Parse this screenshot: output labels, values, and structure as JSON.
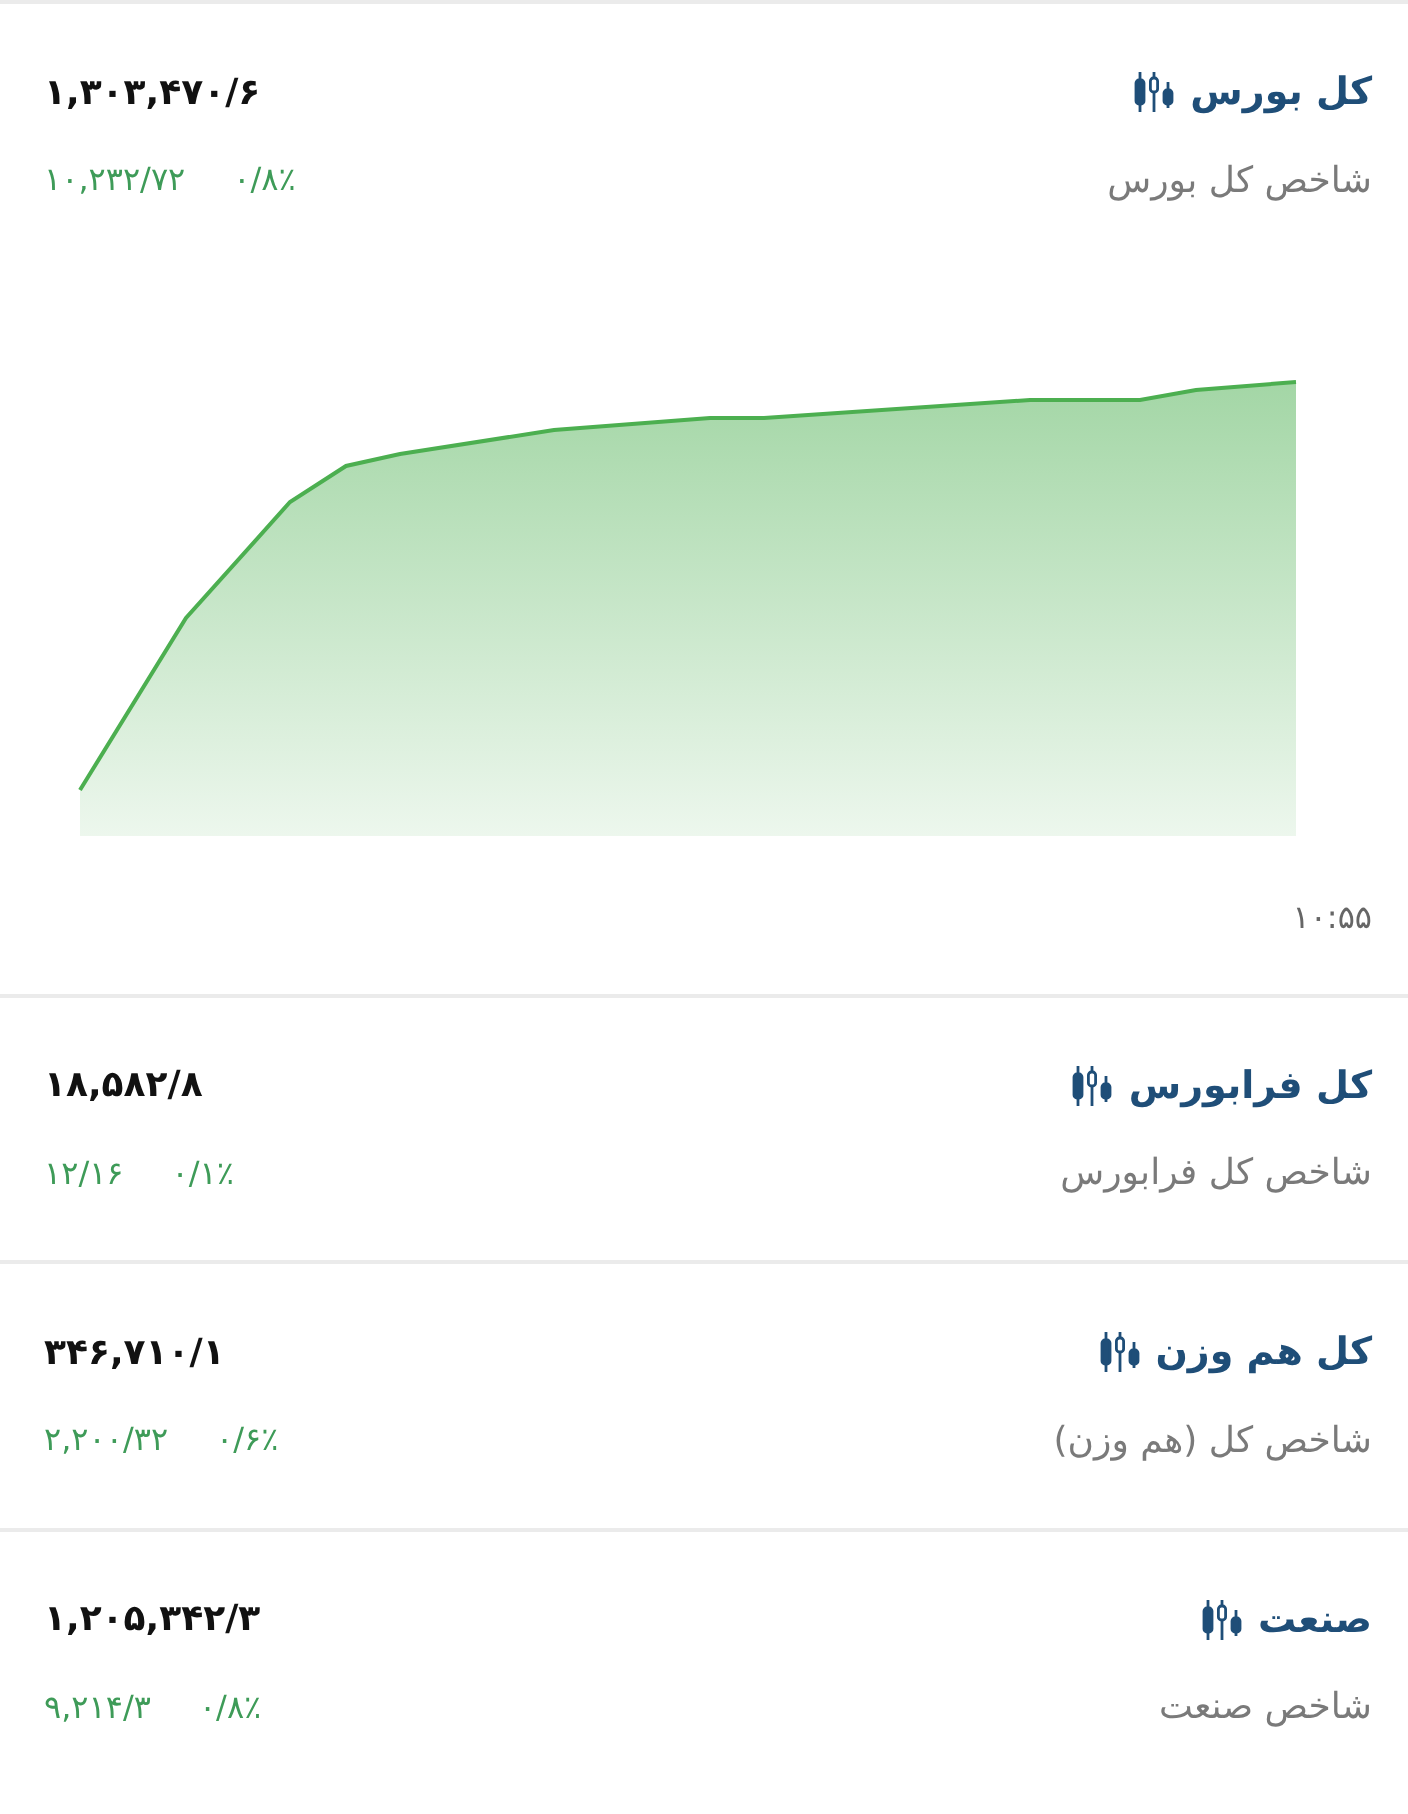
{
  "indices": [
    {
      "name": "کل بورس",
      "description": "شاخص کل بورس",
      "value": "۱,۳۰۳,۴۷۰/۶",
      "change": "۱۰,۲۳۲/۷۲",
      "percent": "۰/۸٪",
      "chart": {
        "kind": "picture",
        "time": "۱۰:۵۵"
      }
    },
    {
      "name": "کل فرابورس",
      "description": "شاخص کل فرابورس",
      "value": "۱۸,۵۸۲/۸",
      "change": "۱۲/۱۶",
      "percent": "۰/۱٪"
    },
    {
      "name": "کل هم وزن",
      "description": "شاخص کل (هم وزن)",
      "value": "۳۴۶,۷۱۰/۱",
      "change": "۲,۲۰۰/۳۲",
      "percent": "۰/۶٪"
    },
    {
      "name": "صنعت",
      "description": "شاخص صنعت",
      "value": "۱,۲۰۵,۳۴۲/۳",
      "change": "۹,۲۱۴/۳",
      "percent": "۰/۸٪"
    }
  ]
}
